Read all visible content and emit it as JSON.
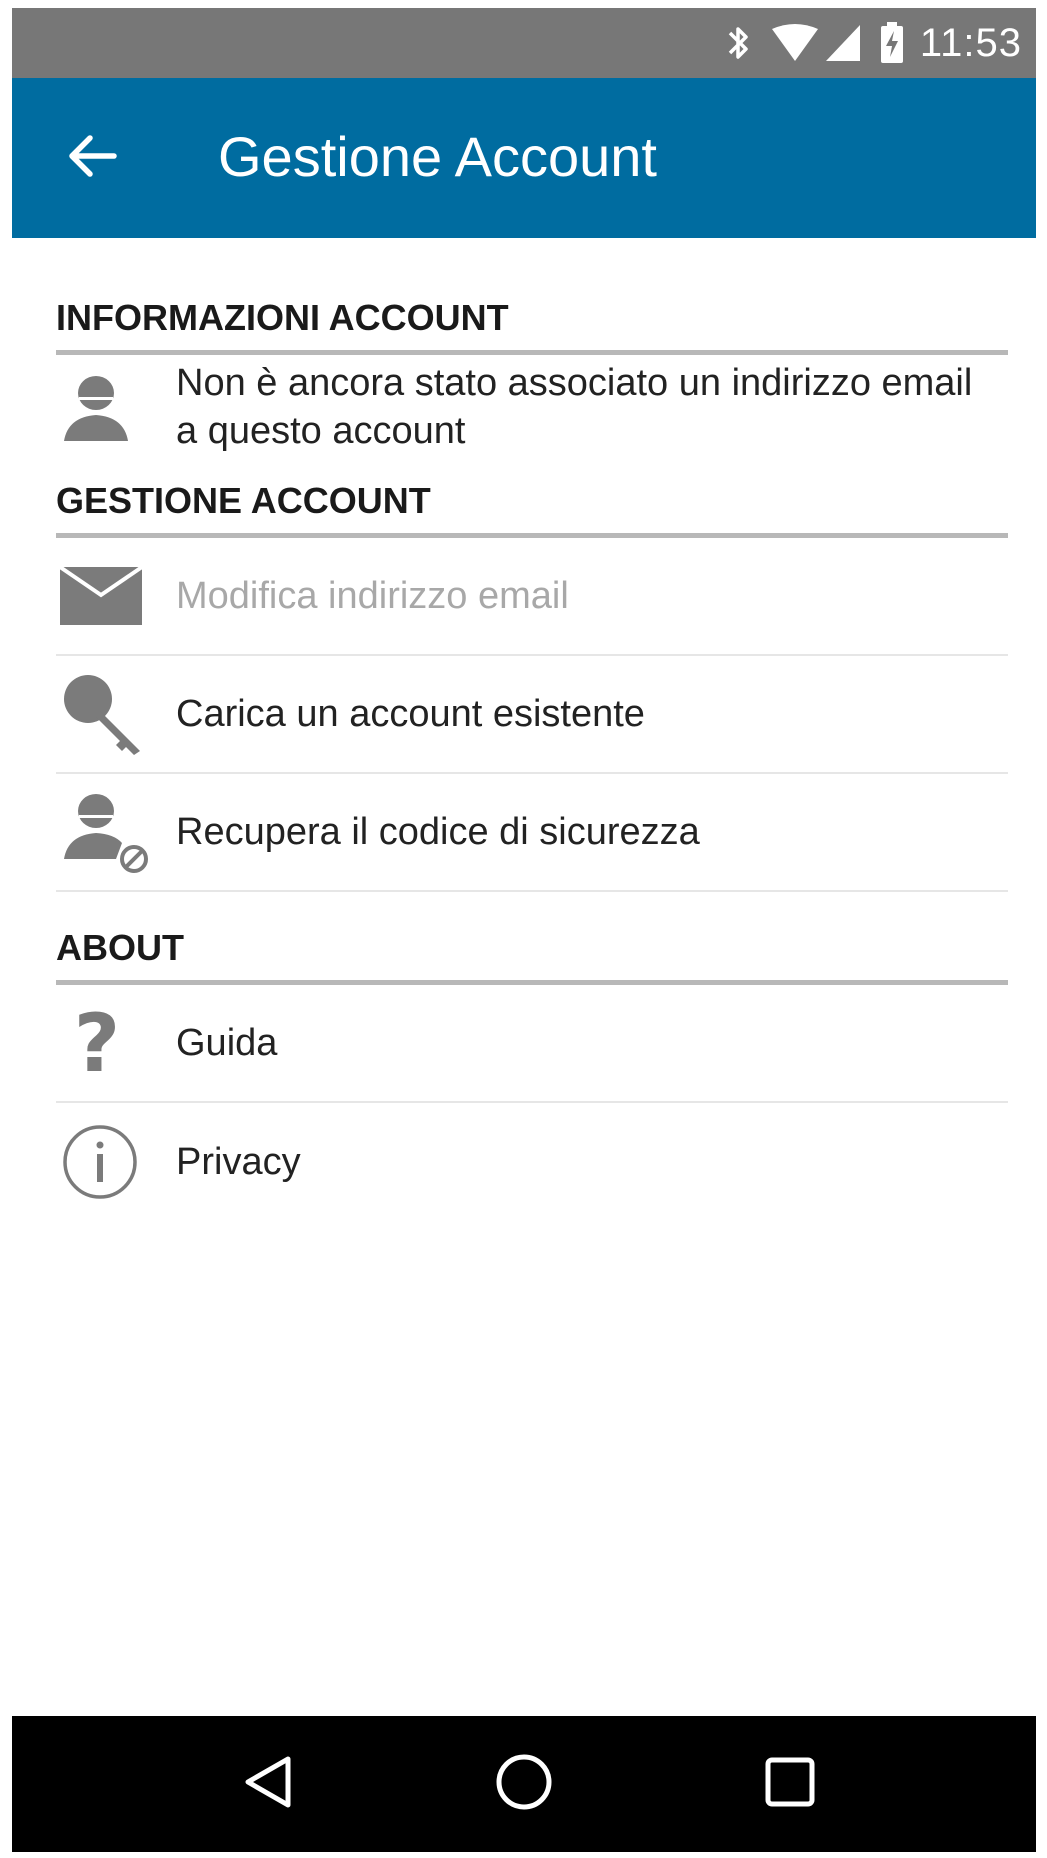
{
  "status_bar": {
    "time": "11:53",
    "icons": [
      "bluetooth-icon",
      "wifi-icon",
      "cell-signal-icon",
      "battery-charging-icon"
    ]
  },
  "app_bar": {
    "title": "Gestione Account",
    "back_icon": "arrow-back-icon",
    "color": "#006ca0"
  },
  "sections": {
    "account_info": {
      "header": "INFORMAZIONI ACCOUNT",
      "items": [
        {
          "icon": "user-icon",
          "label": "Non è ancora stato associato un indirizzo email a questo account"
        }
      ]
    },
    "account_management": {
      "header": "GESTIONE ACCOUNT",
      "items": [
        {
          "icon": "mail-icon",
          "label": "Modifica indirizzo email",
          "disabled": true
        },
        {
          "icon": "key-icon",
          "label": "Carica un account esistente"
        },
        {
          "icon": "user-blocked-icon",
          "label": "Recupera il codice di sicurezza"
        }
      ]
    },
    "about": {
      "header": "ABOUT",
      "items": [
        {
          "icon": "help-icon",
          "label": "Guida"
        },
        {
          "icon": "info-icon",
          "label": "Privacy"
        }
      ]
    }
  },
  "nav_bar": {
    "buttons": [
      "back-triangle-icon",
      "home-circle-icon",
      "recents-square-icon"
    ]
  }
}
